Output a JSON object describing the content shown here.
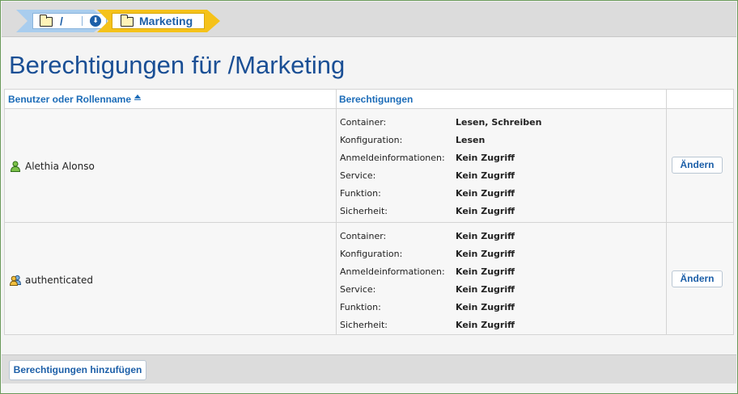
{
  "breadcrumb": {
    "root_label": "/",
    "current_label": "Marketing"
  },
  "page": {
    "title": "Berechtigungen für /Marketing"
  },
  "table": {
    "columns": {
      "user": "Benutzer oder Rollenname",
      "permissions": "Berechtigungen"
    },
    "rows": [
      {
        "user": "Alethia Alonso",
        "user_icon": "user-icon",
        "permissions": [
          {
            "name": "Container:",
            "value": "Lesen, Schreiben"
          },
          {
            "name": "Konfiguration:",
            "value": "Lesen"
          },
          {
            "name": "Anmeldeinformationen:",
            "value": "Kein Zugriff"
          },
          {
            "name": "Service:",
            "value": "Kein Zugriff"
          },
          {
            "name": "Funktion:",
            "value": "Kein Zugriff"
          },
          {
            "name": "Sicherheit:",
            "value": "Kein Zugriff"
          }
        ],
        "action": "Ändern"
      },
      {
        "user": "authenticated",
        "user_icon": "group-icon",
        "permissions": [
          {
            "name": "Container:",
            "value": "Kein Zugriff"
          },
          {
            "name": "Konfiguration:",
            "value": "Kein Zugriff"
          },
          {
            "name": "Anmeldeinformationen:",
            "value": "Kein Zugriff"
          },
          {
            "name": "Service:",
            "value": "Kein Zugriff"
          },
          {
            "name": "Funktion:",
            "value": "Kein Zugriff"
          },
          {
            "name": "Sicherheit:",
            "value": "Kein Zugriff"
          }
        ],
        "action": "Ändern"
      }
    ]
  },
  "footer": {
    "add_label": "Berechtigungen hinzufügen"
  },
  "colors": {
    "link_blue": "#1c5fa8",
    "title_blue": "#1a4f95",
    "crumb_blue": "#a9cdee",
    "crumb_yellow": "#f5c21a"
  }
}
